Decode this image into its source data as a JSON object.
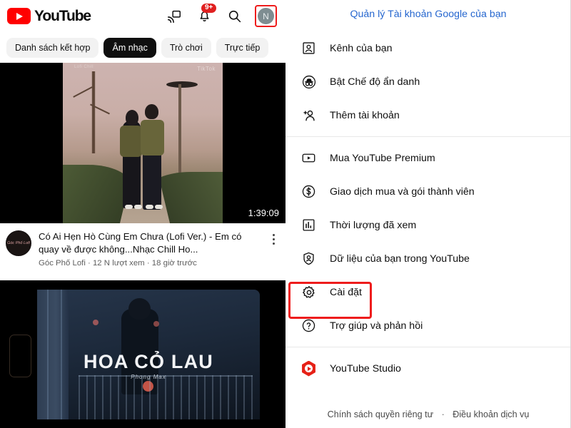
{
  "left": {
    "header": {
      "logo_text": "YouTube",
      "cast_icon": "cast-icon",
      "bell_icon": "bell-icon",
      "notification_badge": "9+",
      "search_icon": "search-icon",
      "avatar_letter": "N"
    },
    "chips": [
      {
        "label": "Danh sách kết hợp",
        "active": false
      },
      {
        "label": "Âm nhạc",
        "active": true
      },
      {
        "label": "Trò chơi",
        "active": false
      },
      {
        "label": "Trực tiếp",
        "active": false
      }
    ],
    "video_top": {
      "duration": "1:39:09",
      "watermark": "TikTok",
      "watermark_left": "Lofi Chill"
    },
    "video_meta": {
      "title": "Có Ai Hẹn Hò Cùng Em Chưa (Lofi Ver.) - Em có quay về được không...Nhạc Chill Ho...",
      "subtitle": "Góc Phố Lofi · 12 N lượt xem · 18 giờ trước",
      "channel_avatar_text": "Góc Phố Lofi",
      "menu_icon": "kebab-menu-icon"
    },
    "video_bottom": {
      "title": "HOA CỎ LAU",
      "artist": "Phong Max"
    }
  },
  "right": {
    "account_link": "Quản lý Tài khoản Google của bạn",
    "group1": [
      {
        "label": "Kênh của bạn",
        "icon": "account-box-icon"
      },
      {
        "label": "Bật Chế độ ẩn danh",
        "icon": "incognito-icon"
      },
      {
        "label": "Thêm tài khoản",
        "icon": "person-add-icon"
      }
    ],
    "group2": [
      {
        "label": "Mua YouTube Premium",
        "icon": "play-box-icon"
      },
      {
        "label": "Giao dịch mua và gói thành viên",
        "icon": "dollar-circle-icon"
      },
      {
        "label": "Thời lượng đã xem",
        "icon": "bar-chart-icon"
      },
      {
        "label": "Dữ liệu của bạn trong YouTube",
        "icon": "shield-person-icon"
      },
      {
        "label": "Cài đặt",
        "icon": "gear-icon"
      },
      {
        "label": "Trợ giúp và phản hồi",
        "icon": "help-circle-icon"
      }
    ],
    "group3": [
      {
        "label": "YouTube Studio",
        "icon": "youtube-studio-icon"
      }
    ],
    "footer": {
      "privacy": "Chính sách quyền riêng tư",
      "separator": "·",
      "terms": "Điều khoản dịch vụ"
    }
  },
  "colors": {
    "brand_red": "#FF0000",
    "highlight_red": "#EE1C1C",
    "link_blue": "#2667cf",
    "chip_active_bg": "#0f0f0f",
    "badge_red": "#E02020"
  }
}
